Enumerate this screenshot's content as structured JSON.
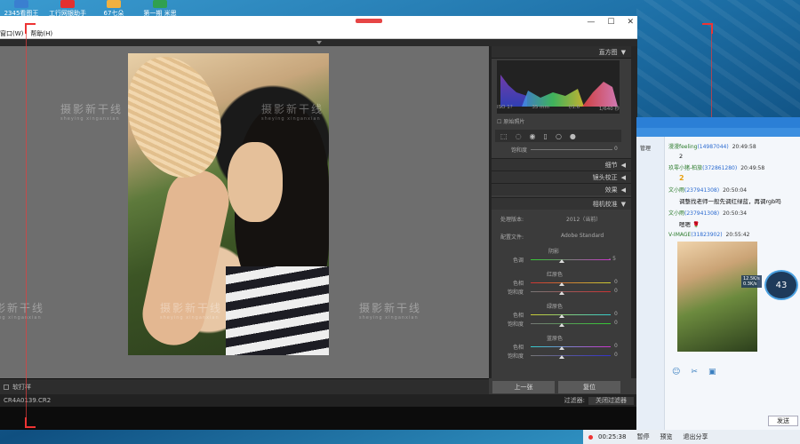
{
  "desktop_icons": [
    {
      "label": "2345看图王",
      "color": "#3a7fd0"
    },
    {
      "label": "工行网银助手",
      "color": "#e33030"
    },
    {
      "label": "67七朵",
      "color": "#f0b040"
    },
    {
      "label": "第一期 米思",
      "color": "#30a050"
    }
  ],
  "window": {
    "min": "—",
    "max": "☐",
    "close": "✕"
  },
  "menu": [
    "窗口(W)",
    "帮助(H)"
  ],
  "watermark": {
    "main": "摄影新干线",
    "sub": "sheying xinganxian"
  },
  "toolbar": {
    "softproof": "软打样"
  },
  "panel": {
    "histogram_title": "直方图",
    "hist_info": [
      "ISO 1?",
      "35 mm",
      "f/1.6",
      "1/640 秒"
    ],
    "original_photo": "原始照片",
    "saturation": "饱和度",
    "saturation_value": "0",
    "sections": [
      "细节",
      "镜头校正",
      "效果",
      "相机校准"
    ],
    "process_label": "处理版本:",
    "process_value": "2012（当前）",
    "profile_label": "配置文件:",
    "profile_value": "Adobe Standard",
    "shadow_title": "阴影",
    "tint_label": "色调",
    "tint_value": "- 5",
    "red_title": "红原色",
    "green_title": "绿原色",
    "blue_title": "蓝原色",
    "hue_label": "色相",
    "sat_label": "饱和度",
    "zero": "0",
    "prev_button": "上一张",
    "reset_button": "复位"
  },
  "filmstrip": {
    "filename": "CR4A0139.CR2",
    "filter_label": "过滤器:",
    "filter_value": "关闭过滤器"
  },
  "chat": {
    "messages": [
      {
        "name": "漫漫feeling",
        "id": "(14987044)",
        "time": "20:49:58",
        "body": "2"
      },
      {
        "name": "玖零小猪-柏旅",
        "id": "(372861280)",
        "time": "20:49:58",
        "body": "2"
      },
      {
        "name": "文小雨",
        "id": "(237941308)",
        "time": "20:50:04",
        "body": "调整找老师一般先调红绿蓝，再调rgb吗"
      },
      {
        "name": "文小雨",
        "id": "(237941308)",
        "time": "20:50:34",
        "body": "嗯嗯 🌹"
      },
      {
        "name": "V-IMAGE",
        "id": "(31823902)",
        "time": "20:55:42",
        "body": ""
      }
    ],
    "badge": "43",
    "badge_up": "12.5K/s",
    "badge_down": "0.3K/s",
    "send": "发送",
    "side_item": "管理"
  },
  "recorder": {
    "time": "00:25:38",
    "items": [
      "暂停",
      "预览",
      "退出分享"
    ]
  }
}
